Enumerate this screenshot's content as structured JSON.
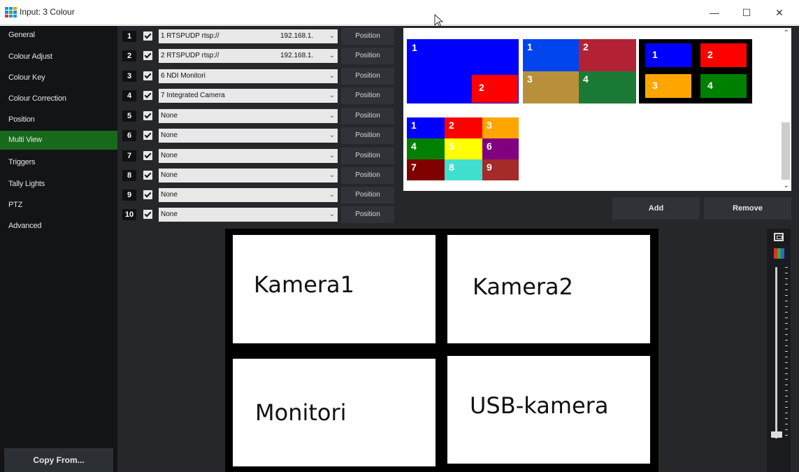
{
  "window": {
    "title": "Input: 3 Colour",
    "minimize": "—",
    "maximize": "☐",
    "close": "✕"
  },
  "sidebar": {
    "items": [
      {
        "label": "General"
      },
      {
        "label": "Colour Adjust"
      },
      {
        "label": "Colour Key"
      },
      {
        "label": "Colour Correction"
      },
      {
        "label": "Position"
      },
      {
        "label": "Multi View"
      },
      {
        "label": "Triggers"
      },
      {
        "label": "Tally Lights"
      },
      {
        "label": "PTZ"
      },
      {
        "label": "Advanced"
      }
    ],
    "active_item": "Multi View",
    "copy_from": "Copy From..."
  },
  "rows": [
    {
      "num": "1",
      "value": "1 RTSPUDP rtsp://",
      "ip": "192.168.1.",
      "position": "Position"
    },
    {
      "num": "2",
      "value": "2 RTSPUDP rtsp://",
      "ip": "192.168.1.",
      "position": "Position"
    },
    {
      "num": "3",
      "value": "6 NDI Monitori",
      "ip": "",
      "position": "Position"
    },
    {
      "num": "4",
      "value": "7 Integrated Camera",
      "ip": "",
      "position": "Position"
    },
    {
      "num": "5",
      "value": "None",
      "ip": "",
      "position": "Position"
    },
    {
      "num": "6",
      "value": "None",
      "ip": "",
      "position": "Position"
    },
    {
      "num": "7",
      "value": "None",
      "ip": "",
      "position": "Position"
    },
    {
      "num": "8",
      "value": "None",
      "ip": "",
      "position": "Position"
    },
    {
      "num": "9",
      "value": "None",
      "ip": "",
      "position": "Position"
    },
    {
      "num": "10",
      "value": "None",
      "ip": "",
      "position": "Position"
    }
  ],
  "layouts": {
    "layout1": [
      "1",
      "2"
    ],
    "layout2": [
      "1",
      "2",
      "3",
      "4"
    ],
    "layout3": [
      "1",
      "2",
      "3",
      "4"
    ],
    "layout4": [
      "1",
      "2",
      "3",
      "4",
      "5",
      "6",
      "7",
      "8",
      "9"
    ]
  },
  "buttons": {
    "add": "Add",
    "remove": "Remove"
  },
  "preview": {
    "cam1": "Kamera1",
    "cam2": "Kamera2",
    "cam3": "Monitori",
    "cam4": "USB-kamera"
  },
  "colors": {
    "active_green": "#176a1c",
    "blue": "#0000ff",
    "red": "#ff0000",
    "dark_red": "#b22234",
    "gold": "#b8903a",
    "green": "#1b7a35",
    "orange": "#ffa500",
    "bright_green": "#008000",
    "yellow": "#ffff00",
    "purple": "#800080",
    "maroon": "#800000",
    "teal": "#40e0d0",
    "brown": "#a52a2a"
  }
}
